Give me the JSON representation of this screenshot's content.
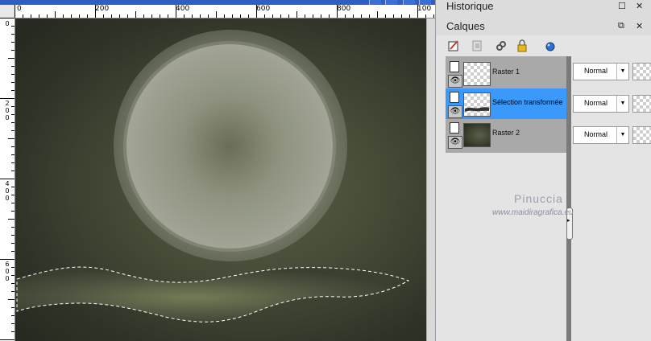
{
  "ruler": {
    "horizontal_labels": [
      "0",
      "200",
      "400",
      "600",
      "800",
      "100"
    ],
    "vertical_labels": [
      {
        "chars": [
          "0"
        ]
      },
      {
        "chars": [
          "2",
          "0",
          "0"
        ]
      },
      {
        "chars": [
          "4",
          "0",
          "0"
        ]
      },
      {
        "chars": [
          "6",
          "0",
          "0"
        ]
      }
    ]
  },
  "panels": {
    "historique": {
      "title": "Historique"
    },
    "calques": {
      "title": "Calques"
    }
  },
  "layers": [
    {
      "name": "Raster 1",
      "blend": "Normal",
      "selected": false,
      "thumb": "transparent"
    },
    {
      "name": "Sélection transformée",
      "blend": "Normal",
      "selected": true,
      "thumb": "transparent"
    },
    {
      "name": "Raster 2",
      "blend": "Normal",
      "selected": false,
      "thumb": "dark"
    }
  ],
  "watermark": {
    "name": "Pinuccia",
    "site": "www.maidiragrafica.eu"
  },
  "colors": {
    "selected_layer": "#3b99fc",
    "title_bar": "#2d5fc4"
  }
}
